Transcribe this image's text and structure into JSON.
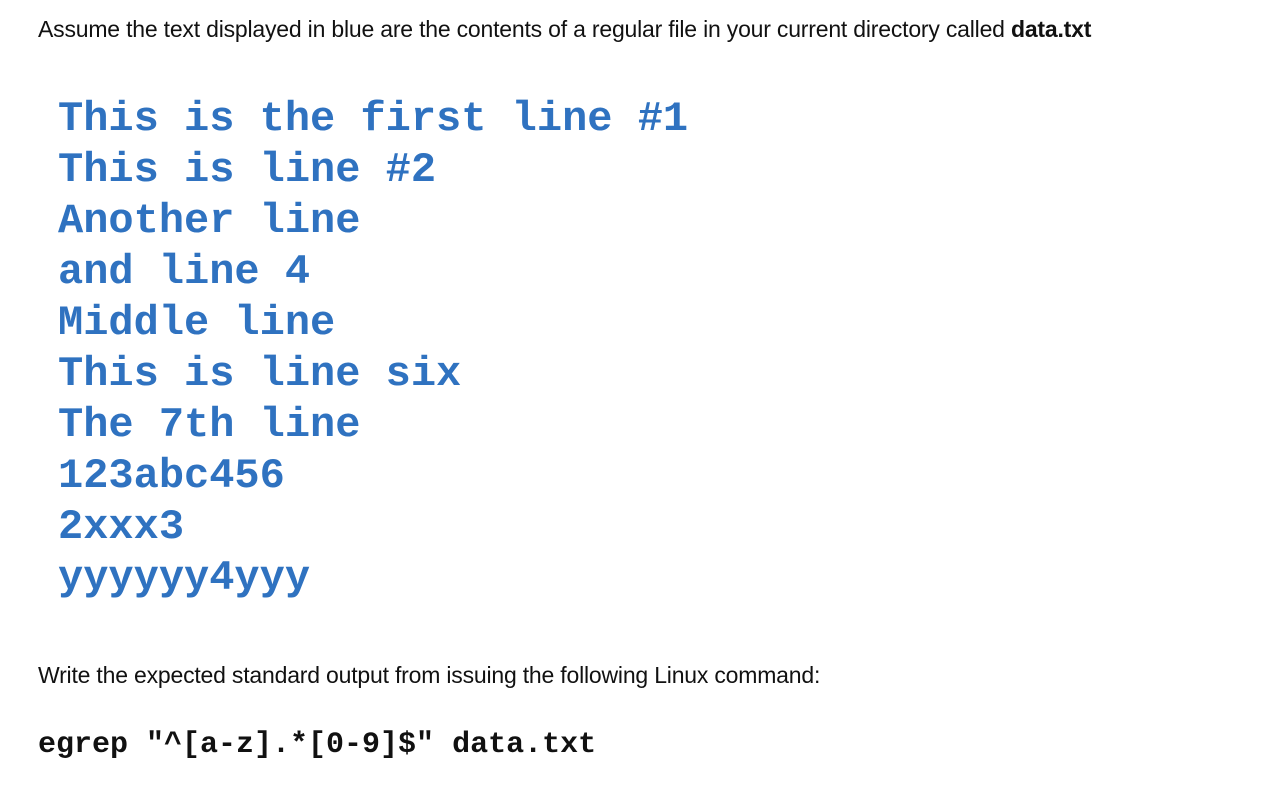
{
  "intro": {
    "text_before": "Assume the text displayed in blue are the contents of a regular file in your current directory called ",
    "filename": "data.txt"
  },
  "file_contents": {
    "color": "#2f72c0",
    "lines": [
      "This is the first line #1",
      "This is line #2",
      "Another line",
      "and line 4",
      "Middle line",
      "This is line six",
      "The 7th line",
      "123abc456",
      "2xxx3",
      "yyyyyy4yyy"
    ]
  },
  "question": {
    "text": "Write the expected standard output from issuing the following Linux command:"
  },
  "command": {
    "text": "egrep \"^[a-z].*[0-9]$\" data.txt"
  }
}
